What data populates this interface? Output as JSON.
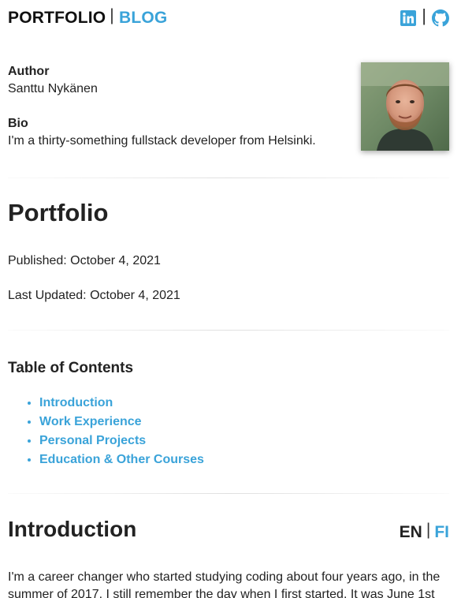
{
  "header": {
    "nav_portfolio": "PORTFOLIO",
    "nav_blog": "BLOG",
    "separator": "|",
    "social_links": [
      {
        "icon": "linkedin-icon",
        "label": "LinkedIn"
      },
      {
        "icon": "github-icon",
        "label": "GitHub"
      }
    ]
  },
  "author": {
    "author_label": "Author",
    "author_name": "Santtu Nykänen",
    "bio_label": "Bio",
    "bio_text": "I'm a thirty-something fullstack developer from Helsinki."
  },
  "page": {
    "title": "Portfolio",
    "published": "Published: October 4, 2021",
    "last_updated": "Last Updated: October 4, 2021"
  },
  "toc": {
    "title": "Table of Contents",
    "items": [
      {
        "label": "Introduction"
      },
      {
        "label": "Work Experience"
      },
      {
        "label": "Personal Projects"
      },
      {
        "label": "Education & Other Courses"
      }
    ]
  },
  "introduction": {
    "title": "Introduction",
    "lang_en": "EN",
    "lang_fi": "FI",
    "text": "I'm a career changer who started studying coding about four years ago, in the summer of 2017. I still remember the day when I first started. It was June 1st"
  },
  "colors": {
    "accent": "#3aa3d9",
    "text": "#222222",
    "background": "#ffffff"
  }
}
